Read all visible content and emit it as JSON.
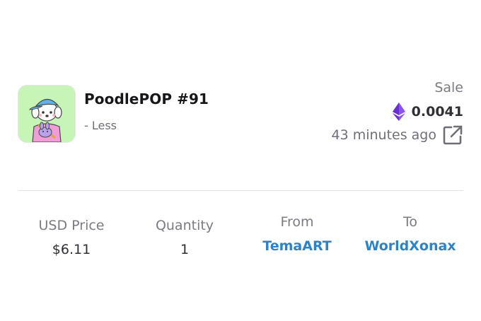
{
  "nft": {
    "title": "PoodlePOP #91",
    "toggle_label": "- Less",
    "thumbnail_icon": "nft-thumbnail"
  },
  "sale": {
    "label": "Sale",
    "price": "0.0041",
    "currency_icon": "ethereum-icon",
    "time_ago": "43 minutes ago",
    "external_icon": "external-link-icon"
  },
  "details": {
    "usd_price_label": "USD Price",
    "usd_price_value": "$6.11",
    "quantity_label": "Quantity",
    "quantity_value": "1",
    "from_label": "From",
    "from_value": "TemaART",
    "to_label": "To",
    "to_value": "WorldXonax"
  },
  "colors": {
    "link": "#2d83c8",
    "ethereum": "#7b3fe4",
    "thumbnail_bg": "#c7f5b8"
  }
}
